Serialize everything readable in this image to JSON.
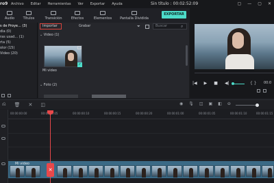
{
  "app": {
    "logo": "ro9",
    "doc_title": "Sin título : 00:02:52:09"
  },
  "menu": [
    "Archivo",
    "Editar",
    "Herramientas",
    "Ver",
    "Exportar",
    "Ayuda"
  ],
  "window_controls": [
    "▢",
    "—",
    "▢",
    "✕"
  ],
  "toolbar": [
    {
      "label": "Audio",
      "icon": "music-icon"
    },
    {
      "label": "Títulos",
      "icon": "text-icon"
    },
    {
      "label": "Transición",
      "icon": "transition-icon"
    },
    {
      "label": "Efectos",
      "icon": "effects-icon"
    },
    {
      "label": "Elementos",
      "icon": "elements-icon"
    },
    {
      "label": "Pantalla Dividida",
      "icon": "split-screen-icon"
    }
  ],
  "export_label": "EXPORTAR",
  "library": {
    "items": [
      {
        "label": "s de Proye...  (3)",
        "active": true
      },
      {
        "label": "dia (0)"
      },
      {
        "label": "ras usad... (1)"
      },
      {
        "label": "rta (5)"
      },
      {
        "label": "olor (15)"
      },
      {
        "label": "Video (20)"
      }
    ]
  },
  "media": {
    "import_label": "Importar",
    "record_label": "Grabar",
    "search_placeholder": "Buscar",
    "sections": [
      "Video (1)",
      "Foto (2)"
    ],
    "clip_name": "Mi video",
    "check_mark": "✓"
  },
  "preview": {
    "time": "00:0",
    "controls": [
      "|◀",
      "▶",
      "■",
      "◀|"
    ],
    "brackets": "{ }"
  },
  "timeline": {
    "left_tools": [
      "⎌",
      "🗑",
      "✕",
      "◫"
    ],
    "right_tools": [
      "◉",
      "🎙",
      "◫",
      "▣",
      "◧",
      "⊖"
    ],
    "ticks": [
      "00:00:00:00",
      "00:00:00:05",
      "00:00:00:10",
      "00:00:00:15",
      "00:00:00:20",
      "00:00:01:00",
      "00:00:01:05",
      "00:00:01:10",
      "00:00:01:15"
    ],
    "clip_label": "Mi video",
    "split_marker": "✕"
  },
  "colors": {
    "accent": "#4ddbc9",
    "playhead": "#e8484a",
    "clip": "#3b6a86"
  }
}
